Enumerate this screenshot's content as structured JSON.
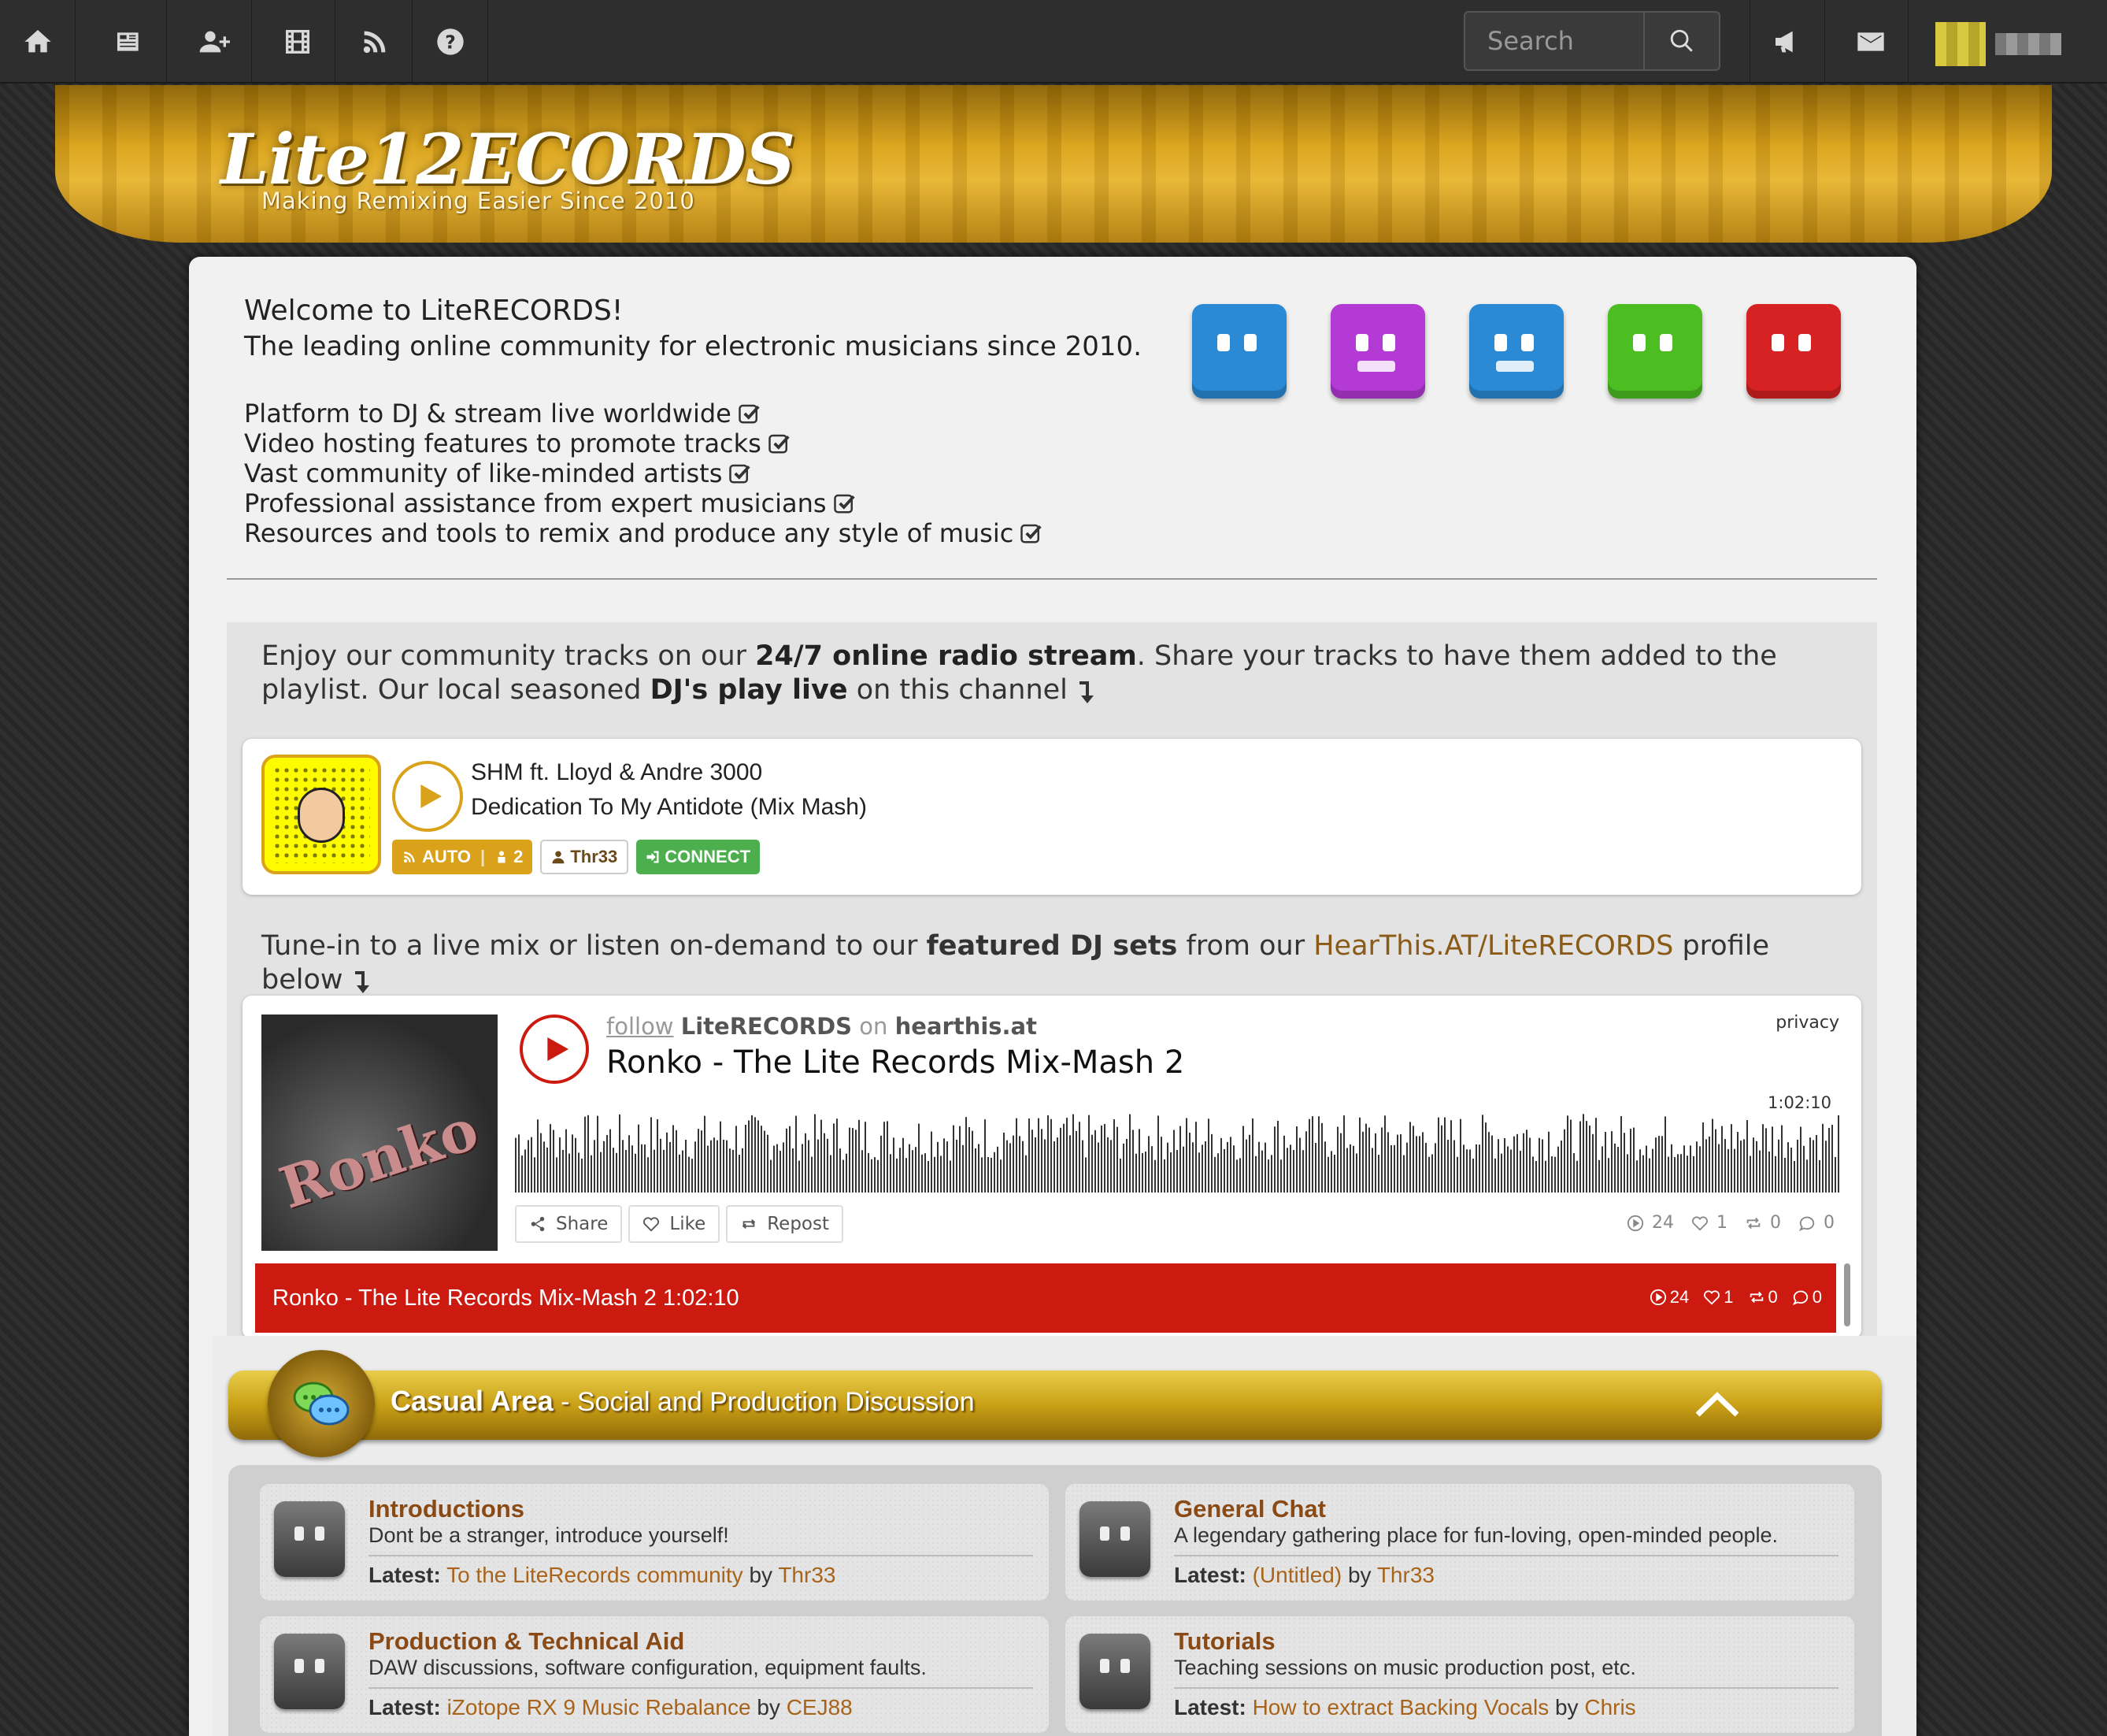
{
  "nav": {
    "icons": [
      "home-icon",
      "news-icon",
      "add-user-icon",
      "film-icon",
      "rss-icon",
      "help-icon"
    ],
    "search": {
      "placeholder": "Search"
    },
    "right_icons": [
      "megaphone-icon",
      "envelope-icon"
    ]
  },
  "banner": {
    "logo": "Lite12ECORDS",
    "tagline": "Making Remixing Easier Since 2010"
  },
  "welcome": {
    "title": "Welcome to LiteRECORDS!",
    "subtitle": "The leading online community for electronic musicians since 2010.",
    "features": [
      "Platform to DJ & stream live worldwide",
      "Video hosting features to promote tracks",
      "Vast community of like-minded artists",
      "Professional assistance from expert musicians",
      "Resources and tools to remix and produce any style of music"
    ],
    "robot_colors": [
      "#2a8ad6",
      "#b43ad6",
      "#2a8ad6",
      "#4cbe22",
      "#d62222"
    ]
  },
  "radio": {
    "intro_pre": "Enjoy our community tracks on our ",
    "intro_bold1": "24/7 online radio stream",
    "intro_mid": ". Share your tracks to have them added to the playlist. Our local seasoned ",
    "intro_bold2": "DJ's play live",
    "intro_post": " on this channel",
    "player": {
      "artist": "SHM ft. Lloyd & Andre 3000",
      "title": "Dedication To My Antidote (Mix Mash)",
      "auto_label": "AUTO",
      "listeners": "2",
      "user": "Thr33",
      "connect_label": "CONNECT"
    },
    "tune_pre": "Tune-in to a live mix or listen on-demand to our ",
    "tune_bold": "featured DJ sets",
    "tune_mid": " from our ",
    "tune_link": "HearThis.AT/LiteRECORDS",
    "tune_post": " profile below"
  },
  "hearthis": {
    "cover_text": "Ronko",
    "follow": "follow",
    "account": "LiteRECORDS",
    "on": "on",
    "site": "hearthis.at",
    "title": "Ronko - The Lite Records Mix-Mash 2",
    "privacy": "privacy",
    "duration": "1:02:10",
    "share_label": "Share",
    "like_label": "Like",
    "repost_label": "Repost",
    "plays": "24",
    "likes": "1",
    "reposts": "0",
    "comments": "0",
    "playlist_title": "Ronko - The Lite Records Mix-Mash 2",
    "playlist_duration": "1:02:10"
  },
  "casual": {
    "title": "Casual Area",
    "subtitle": " - Social and Production Discussion",
    "forums": [
      {
        "title": "Introductions",
        "desc": "Dont be a stranger, introduce yourself!",
        "latest_label": "Latest:",
        "latest_topic": "To the LiteRecords community",
        "by": "by",
        "author": "Thr33"
      },
      {
        "title": "General Chat",
        "desc": "A legendary gathering place for fun-loving, open-minded people.",
        "latest_label": "Latest:",
        "latest_topic": "(Untitled)",
        "by": "by",
        "author": "Thr33"
      },
      {
        "title": "Production & Technical Aid",
        "desc": "DAW discussions, software configuration, equipment faults.",
        "latest_label": "Latest:",
        "latest_topic": "iZotope RX 9 Music Rebalance",
        "by": "by",
        "author": "CEJ88"
      },
      {
        "title": "Tutorials",
        "desc": "Teaching sessions on music production post, etc.",
        "latest_label": "Latest:",
        "latest_topic": "How to extract Backing Vocals",
        "by": "by",
        "author": "Chris"
      }
    ]
  }
}
